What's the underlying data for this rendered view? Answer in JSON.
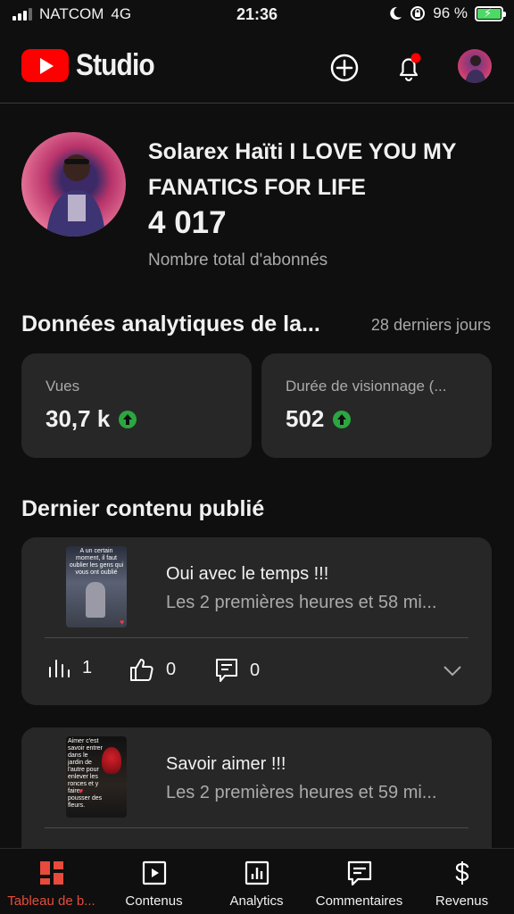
{
  "status_bar": {
    "carrier": "NATCOM",
    "network": "4G",
    "time": "21:36",
    "battery": "96 %"
  },
  "header": {
    "logo_text": "Studio",
    "icons": [
      "create-plus-icon",
      "notification-bell-icon",
      "account-avatar"
    ],
    "notification_dot_color": "#ff0000"
  },
  "channel": {
    "name": "Solarex Haïti  I LOVE YOU MY FANATICS FOR LIFE",
    "subscribers": "4 017",
    "subscribers_label": "Nombre total d'abonnés"
  },
  "analytics": {
    "title": "Données analytiques de la...",
    "period": "28 derniers jours",
    "cards": [
      {
        "label": "Vues",
        "value": "30,7 k",
        "trend": "up"
      },
      {
        "label": "Durée de visionnage (...",
        "value": "502",
        "trend": "up"
      }
    ],
    "trend_color": "#2ba640"
  },
  "latest": {
    "title": "Dernier contenu publié",
    "videos": [
      {
        "thumbnail_text": "A un certain moment, il faut oublier les gens qui vous ont oublié",
        "title": "Oui avec le temps !!!",
        "meta": "Les 2 premières heures et 58 mi...",
        "views": "1",
        "likes": "0",
        "comments": "0"
      },
      {
        "thumbnail_text": "Aimer c'est savoir entrer dans le jardin de l'autre pour enlever les ronces et y faire pousser des fleurs.",
        "title": "Savoir aimer !!!",
        "meta": "Les 2 premières heures et 59 mi..."
      }
    ]
  },
  "bottom_nav": {
    "active_color": "#e84b3c",
    "items": [
      {
        "label": "Tableau de b...",
        "icon": "dashboard-icon",
        "active": true
      },
      {
        "label": "Contenus",
        "icon": "content-icon"
      },
      {
        "label": "Analytics",
        "icon": "analytics-icon"
      },
      {
        "label": "Commentaires",
        "icon": "comments-icon"
      },
      {
        "label": "Revenus",
        "icon": "dollar-icon"
      }
    ]
  }
}
